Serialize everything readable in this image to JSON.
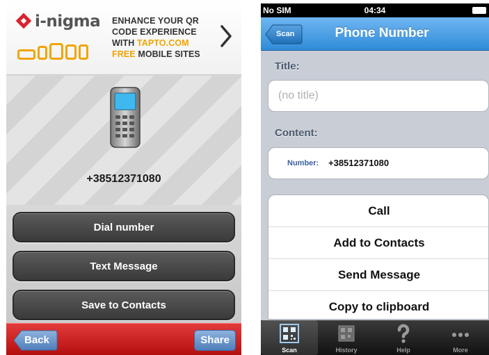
{
  "left_app": {
    "brand": "i-nigma",
    "ad": {
      "line1": "ENHANCE YOUR QR",
      "line2": "CODE EXPERIENCE",
      "line3_prefix": "WITH ",
      "line3_highlight": "TAPTO.COM",
      "line4_highlight": "FREE",
      "line4_suffix": " MOBILE SITES"
    },
    "number": "+38512371080",
    "buttons": [
      "Dial number",
      "Text Message",
      "Save to Contacts"
    ],
    "back_label": "Back",
    "share_label": "Share"
  },
  "right_app": {
    "status": {
      "carrier": "No SIM",
      "time": "04:34"
    },
    "nav": {
      "back_label": "Scan",
      "title": "Phone Number"
    },
    "title_label": "Title:",
    "title_placeholder": "(no title)",
    "content_label": "Content:",
    "content_key": "Number:",
    "content_value": "+38512371080",
    "actions": [
      "Call",
      "Add to Contacts",
      "Send Message",
      "Copy to clipboard"
    ],
    "tabs": [
      {
        "label": "Scan",
        "icon": "qr-scan-icon",
        "active": true
      },
      {
        "label": "History",
        "icon": "history-icon",
        "active": false
      },
      {
        "label": "Help",
        "icon": "question-mark-icon",
        "active": false
      },
      {
        "label": "More",
        "icon": "more-dots-icon",
        "active": false
      }
    ]
  },
  "colors": {
    "brand_red": "#d9232f",
    "brand_orange": "#f0a400",
    "bottom_bar_red": "#c41a1a",
    "ios_nav_blue": "#2f8bd8"
  }
}
